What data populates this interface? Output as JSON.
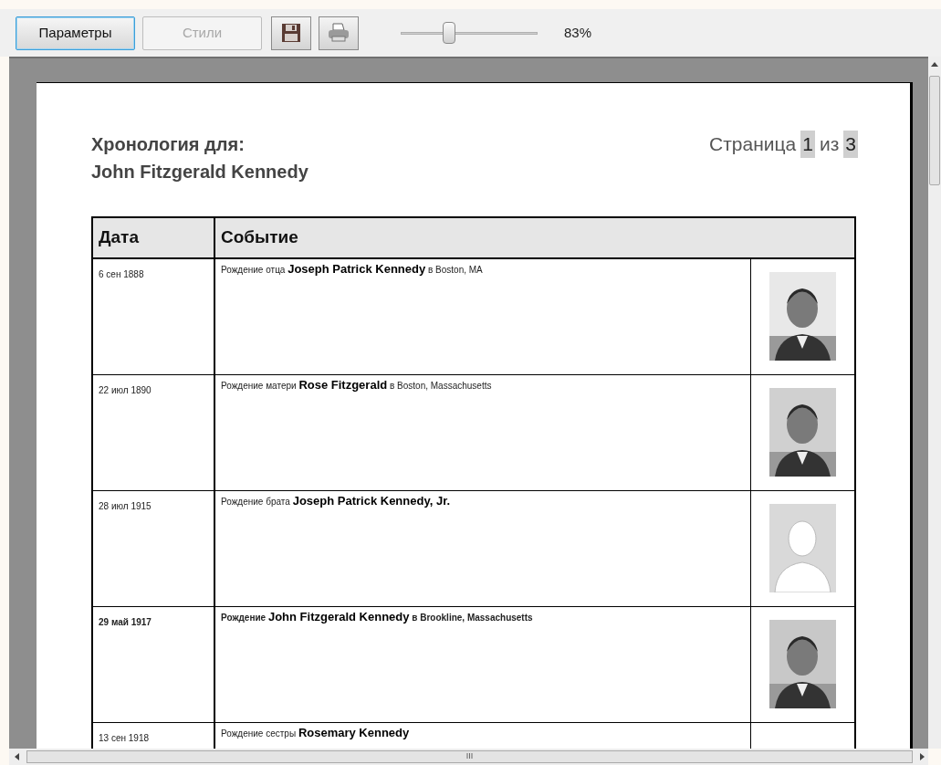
{
  "toolbar": {
    "buttons": [
      {
        "label": "Параметры",
        "disabled": false,
        "selected": true
      },
      {
        "label": "Стили",
        "disabled": true,
        "selected": false
      }
    ],
    "zoom": {
      "level": 0.35,
      "reading": "83%"
    }
  },
  "page": {
    "title_lines": [
      "Хронология для:",
      "John Fitzgerald Kennedy"
    ],
    "pager": {
      "prefix": "Страница",
      "current": "1",
      "middle": "из",
      "total": "3"
    },
    "table": {
      "columns": [
        "Дата",
        "Событие"
      ],
      "rows": [
        {
          "date": "6 сен 1888",
          "event": "Рождение отца **Joseph Patrick Kennedy** в Boston, MA",
          "bold": false,
          "kind": "picture"
        },
        {
          "date": "22 июл 1890",
          "event": "Рождение матери **Rose Fitzgerald** в Boston, Massachusetts",
          "bold": false,
          "kind": "picture"
        },
        {
          "date": "28 июл 1915",
          "event": "Рождение брата **Joseph Patrick Kennedy, Jr.**",
          "bold": false,
          "kind": "silhouette"
        },
        {
          "date": "29 май 1917",
          "event": "Рождение **John Fitzgerald Kennedy** в Brookline, Massachusetts",
          "bold": true,
          "kind": "picture"
        },
        {
          "date": "13 сен 1918",
          "event": "Рождение сестры **Rosemary Kennedy**",
          "bold": false,
          "kind": "blank"
        }
      ]
    }
  },
  "scrollbar": {
    "grip": "III"
  }
}
